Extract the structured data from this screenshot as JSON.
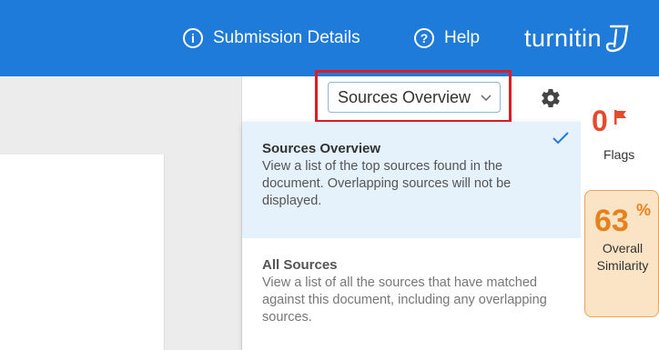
{
  "header": {
    "submission_details": "Submission Details",
    "help": "Help",
    "logo": "turnitin",
    "info_icon_glyph": "i",
    "help_icon_glyph": "?"
  },
  "panel": {
    "view_selector": {
      "selected": "Sources Overview",
      "options": [
        {
          "title": "Sources Overview",
          "description": "View a list of the top sources found in the document. Overlapping sources will not be displayed.",
          "selected": true
        },
        {
          "title": "All Sources",
          "description": "View a list of all the sources that have matched against this document, including any overlapping sources.",
          "selected": false
        }
      ]
    }
  },
  "rail": {
    "flags_count": "0",
    "flags_label": "Flags",
    "similarity_value": "63",
    "similarity_unit": "%",
    "similarity_label": "Overall Similarity"
  },
  "colors": {
    "brand_blue": "#1f7bd9",
    "flag_red": "#e34b2c",
    "similarity_orange": "#e6811c",
    "highlight_red": "#e01b24"
  }
}
